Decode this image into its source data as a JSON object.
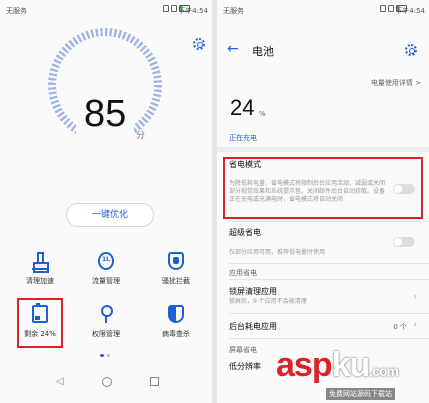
{
  "left": {
    "status": {
      "carrier": "无服务",
      "time": "下午4:54"
    },
    "score": {
      "value": "85",
      "unit": "分"
    },
    "optimize_button": "一键优化",
    "tiles": [
      {
        "label": "清理加速",
        "icon": "broom-icon"
      },
      {
        "label": "流量管理",
        "icon": "traffic-icon"
      },
      {
        "label": "骚扰拦截",
        "icon": "block-shield-icon"
      },
      {
        "label": "剩余 24%",
        "icon": "battery-icon"
      },
      {
        "label": "权限管理",
        "icon": "key-icon"
      },
      {
        "label": "病毒查杀",
        "icon": "virus-shield-icon"
      }
    ]
  },
  "right": {
    "status": {
      "carrier": "无服务",
      "time": "下午4:54"
    },
    "title": "电池",
    "usage_link": "电量使用详情 >",
    "battery": {
      "value": "24",
      "unit": "%",
      "state": "正在充电"
    },
    "power_saving": {
      "title": "省电模式",
      "desc": "为降低耗电量，省电模式将限制后台应用活动、减弱或关闭部分视觉效果和系统提示音。关闭邮件后台自动获取。设备正在充电或充满电时，省电模式将自动关闭"
    },
    "ultra_saving": {
      "title": "超级省电",
      "desc": "仅部分应用可用，推荐低电量时使用"
    },
    "section_app": "应用省电",
    "lock_clean": {
      "title": "锁屏清理应用",
      "desc": "锁屏后，9 个应用不会被清理"
    },
    "bg_drain": {
      "title": "后台耗电应用",
      "value": "0 个"
    },
    "section_screen": "屏幕省电",
    "low_res": "低分辨率"
  },
  "nav": {
    "back": "◁",
    "home": "○",
    "recent": "□"
  },
  "watermark": {
    "logo_a": "asp",
    "logo_b": "ku",
    "logo_c": ".com",
    "sub": "免费网站源码下载站"
  },
  "colors": {
    "accent": "#1e5fd8",
    "highlight": "#d8232a"
  }
}
